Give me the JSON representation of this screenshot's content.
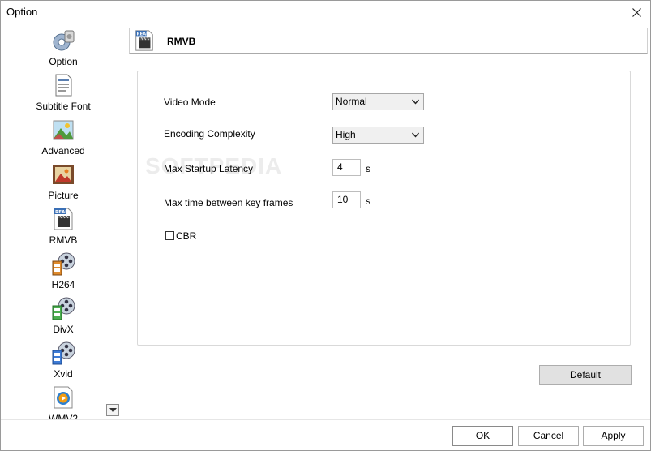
{
  "window": {
    "title": "Option"
  },
  "sidebar": {
    "items": [
      {
        "label": "Option",
        "icon": "option-gear-icon"
      },
      {
        "label": "Subtitle Font",
        "icon": "document-icon"
      },
      {
        "label": "Advanced",
        "icon": "landscape-icon"
      },
      {
        "label": "Picture",
        "icon": "picture-icon"
      },
      {
        "label": "RMVB",
        "icon": "real-clapper-icon"
      },
      {
        "label": "H264",
        "icon": "film-reel-icon"
      },
      {
        "label": "DivX",
        "icon": "film-reel-icon"
      },
      {
        "label": "Xvid",
        "icon": "film-reel-icon"
      },
      {
        "label": "WMV2",
        "icon": "wmv-icon"
      }
    ]
  },
  "header": {
    "title": "RMVB",
    "badge": "REAL"
  },
  "form": {
    "video_mode": {
      "label": "Video Mode",
      "value": "Normal"
    },
    "encoding_complexity": {
      "label": "Encoding Complexity",
      "value": "High"
    },
    "max_startup_latency": {
      "label": "Max Startup Latency",
      "value": "4",
      "unit": "s"
    },
    "max_keyframe_interval": {
      "label": "Max time between key frames",
      "value": "10",
      "unit": "s"
    },
    "cbr": {
      "label": "CBR",
      "checked": false
    }
  },
  "watermark": "SOFTPEDIA",
  "buttons": {
    "default": "Default",
    "ok": "OK",
    "cancel": "Cancel",
    "apply": "Apply"
  }
}
